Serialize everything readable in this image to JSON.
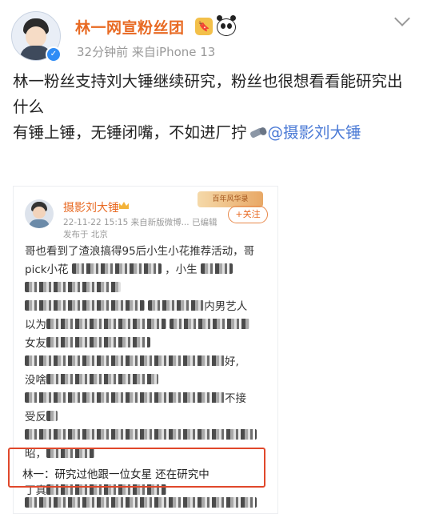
{
  "header": {
    "username": "林一网宣粉丝团",
    "meta": "32分钟前  来自iPhone 13",
    "badge_glyph": "🔖",
    "verify_glyph": "✓"
  },
  "post": {
    "line1": "林一粉丝支持刘大锤继续研究，粉丝也很想看看能研究出什么",
    "line2_prefix": "有锤上锤，无锤闭嘴，不如进厂拧",
    "mention": "@摄影刘大锤"
  },
  "card": {
    "name": "摄影刘大锤",
    "time": "22-11-22 15:15  来自新版微博... 已编辑",
    "from": "发布于 北京",
    "stamp": "百年风华录",
    "follow": "+关注",
    "lines": [
      "哥也看到了渣浪搞得95后小生小花推荐活动，哥",
      "pick小花",
      "",
      "内男艺人",
      "以为",
      "女友",
      "好,",
      "没啥",
      "不接",
      "受反",
      "",
      "昭，",
      "",
      "丁真"
    ],
    "highlight": "林一：研究过他跟一位女星 还在研究中"
  },
  "colors": {
    "username": "#e86a23",
    "mention": "#4c7bd6",
    "verify": "#2f8cf5",
    "highlight_box": "#e0482b"
  }
}
